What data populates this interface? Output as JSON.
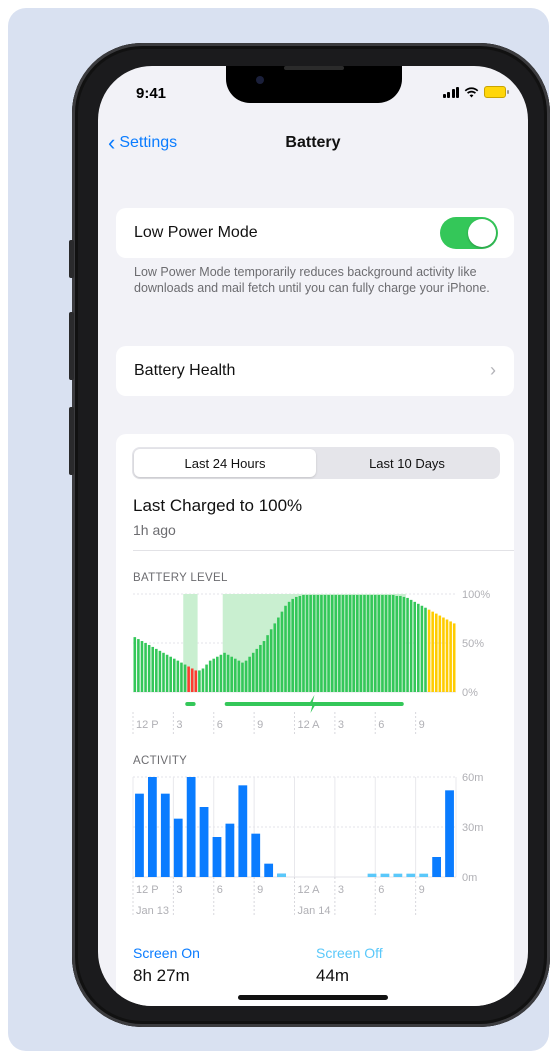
{
  "status": {
    "time": "9:41"
  },
  "nav": {
    "back_label": "Settings",
    "title": "Battery"
  },
  "low_power": {
    "label": "Low Power Mode",
    "enabled": true,
    "description": "Low Power Mode temporarily reduces background activity like downloads and mail fetch until you can fully charge your iPhone."
  },
  "battery_health": {
    "label": "Battery Health"
  },
  "usage": {
    "segments": [
      "Last 24 Hours",
      "Last 10 Days"
    ],
    "selected_segment": "Last 24 Hours",
    "last_charged": "Last Charged to 100%",
    "last_charged_ago": "1h ago",
    "battery_level_label": "BATTERY LEVEL",
    "activity_label": "ACTIVITY",
    "screen_on_label": "Screen On",
    "screen_on_value": "8h 27m",
    "screen_off_label": "Screen Off",
    "screen_off_value": "44m"
  },
  "colors": {
    "accent": "#0a7cff",
    "toggle_on": "#34c759",
    "battery_green": "#34c759",
    "charging_band": "#c9efd0",
    "low_red": "#ff3b30",
    "low_power_yellow": "#ffcc00",
    "activity_on": "#0a7cff",
    "activity_off": "#5ac8fa"
  },
  "chart_data": [
    {
      "type": "bar",
      "title": "BATTERY LEVEL",
      "ylim": [
        0,
        100
      ],
      "y_ticks": [
        "100%",
        "50%",
        "0%"
      ],
      "x_ticks": [
        "12 P",
        "3",
        "6",
        "9",
        "12 A",
        "3",
        "6",
        "9"
      ],
      "values": [
        56,
        54,
        52,
        50,
        48,
        46,
        44,
        42,
        40,
        38,
        36,
        34,
        32,
        30,
        28,
        26,
        24,
        22,
        22,
        24,
        28,
        32,
        34,
        36,
        38,
        40,
        38,
        36,
        34,
        32,
        30,
        32,
        36,
        40,
        44,
        48,
        52,
        58,
        64,
        70,
        76,
        82,
        88,
        92,
        95,
        97,
        98,
        99,
        99,
        99,
        99,
        99,
        99,
        99,
        99,
        99,
        99,
        99,
        99,
        99,
        99,
        99,
        99,
        99,
        99,
        99,
        99,
        99,
        99,
        99,
        99,
        99,
        99,
        98,
        98,
        97,
        96,
        94,
        92,
        90,
        88,
        86,
        84,
        82,
        80,
        78,
        76,
        74,
        72,
        70
      ],
      "low_indices": [
        15,
        16,
        17
      ],
      "low_power_indices": [
        82,
        83,
        84,
        85,
        86,
        87,
        88,
        89
      ],
      "charging_ranges": [
        [
          14,
          17
        ],
        [
          25,
          75
        ]
      ]
    },
    {
      "type": "bar",
      "title": "ACTIVITY",
      "ylim": [
        0,
        60
      ],
      "y_ticks": [
        "60m",
        "30m",
        "0m"
      ],
      "x_ticks": [
        "12 P",
        "3",
        "6",
        "9",
        "12 A",
        "3",
        "6",
        "9"
      ],
      "date_labels": [
        "Jan 13",
        "Jan 14"
      ],
      "series": [
        {
          "name": "Screen On",
          "values": [
            50,
            60,
            50,
            35,
            60,
            42,
            24,
            32,
            55,
            26,
            8,
            2,
            0,
            0,
            0,
            0,
            0,
            0,
            0,
            0,
            0,
            0,
            0,
            12,
            52
          ]
        },
        {
          "name": "Screen Off",
          "values": [
            0,
            0,
            0,
            0,
            0,
            0,
            0,
            0,
            0,
            0,
            0,
            2,
            0,
            0,
            0,
            0,
            0,
            0,
            2,
            2,
            2,
            2,
            2,
            0,
            0
          ]
        }
      ]
    }
  ]
}
